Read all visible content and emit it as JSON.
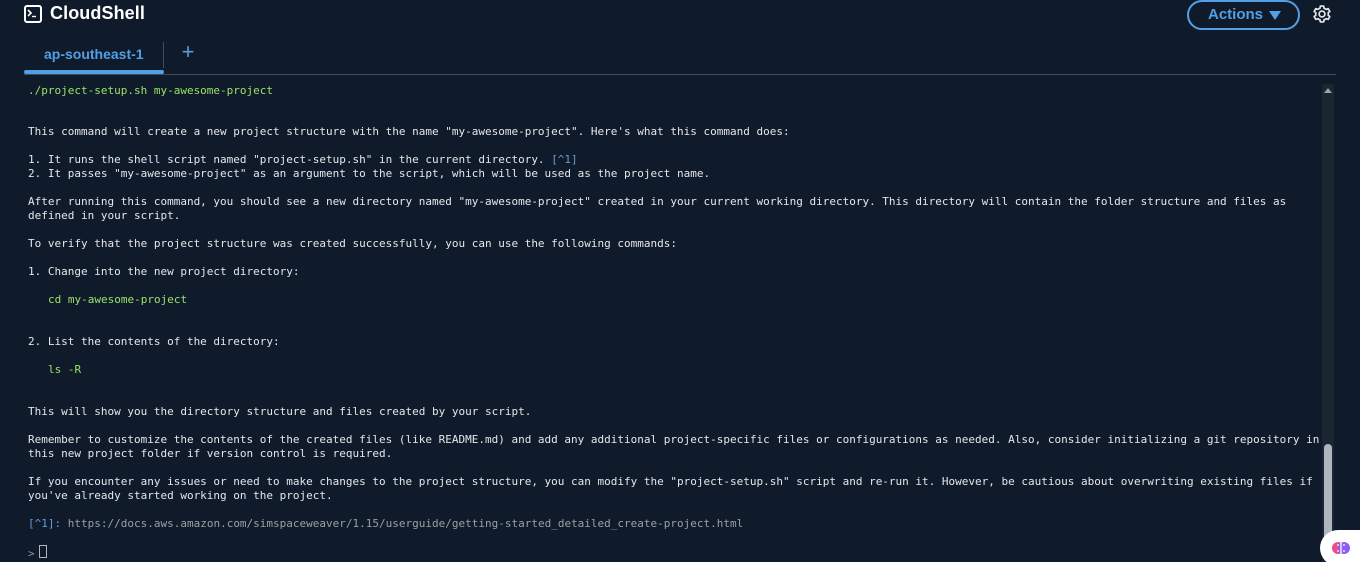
{
  "header": {
    "title": "CloudShell",
    "app_icon": "terminal-icon",
    "actions_label": "Actions",
    "settings_icon": "gear-icon"
  },
  "tabs": [
    {
      "label": "ap-southeast-1",
      "active": true
    }
  ],
  "add_tab_label": "+",
  "terminal": {
    "command": "./project-setup.sh my-awesome-project",
    "intro": "This command will create a new project structure with the name \"my-awesome-project\". Here's what this command does:",
    "step1": "1. It runs the shell script named \"project-setup.sh\" in the current directory.",
    "step1_ref": "[^1]",
    "step2": "2. It passes \"my-awesome-project\" as an argument to the script, which will be used as the project name.",
    "after_1": "After running this command, you should see a new directory named \"my-awesome-project\" created in your current working directory. This directory will contain the folder structure and files as",
    "after_2": "defined in your script.",
    "verify": "To verify that the project structure was created successfully, you can use the following commands:",
    "verify_step1": "1. Change into the new project directory:",
    "verify_cmd1": "cd my-awesome-project",
    "verify_step2": "2. List the contents of the directory:",
    "verify_cmd2": "ls -R",
    "show": "This will show you the directory structure and files created by your script.",
    "remember_1": "Remember to customize the contents of the created files (like README.md) and add any additional project-specific files or configurations as needed. Also, consider initializing a git repository in",
    "remember_2": "this new project folder if version control is required.",
    "issues_1": "If you encounter any issues or need to make changes to the project structure, you can modify the \"project-setup.sh\" script and re-run it. However, be cautious about overwriting existing files if",
    "issues_2": "you've already started working on the project.",
    "footnote_ref": "[^1]:",
    "footnote_url": "https://docs.aws.amazon.com/simspaceweaver/1.15/userguide/getting-started_detailed_create-project.html",
    "prompt_symbol": ">"
  },
  "colors": {
    "background": "#0f1b2a",
    "accent": "#539fe5",
    "command_green": "#9ae36a"
  }
}
